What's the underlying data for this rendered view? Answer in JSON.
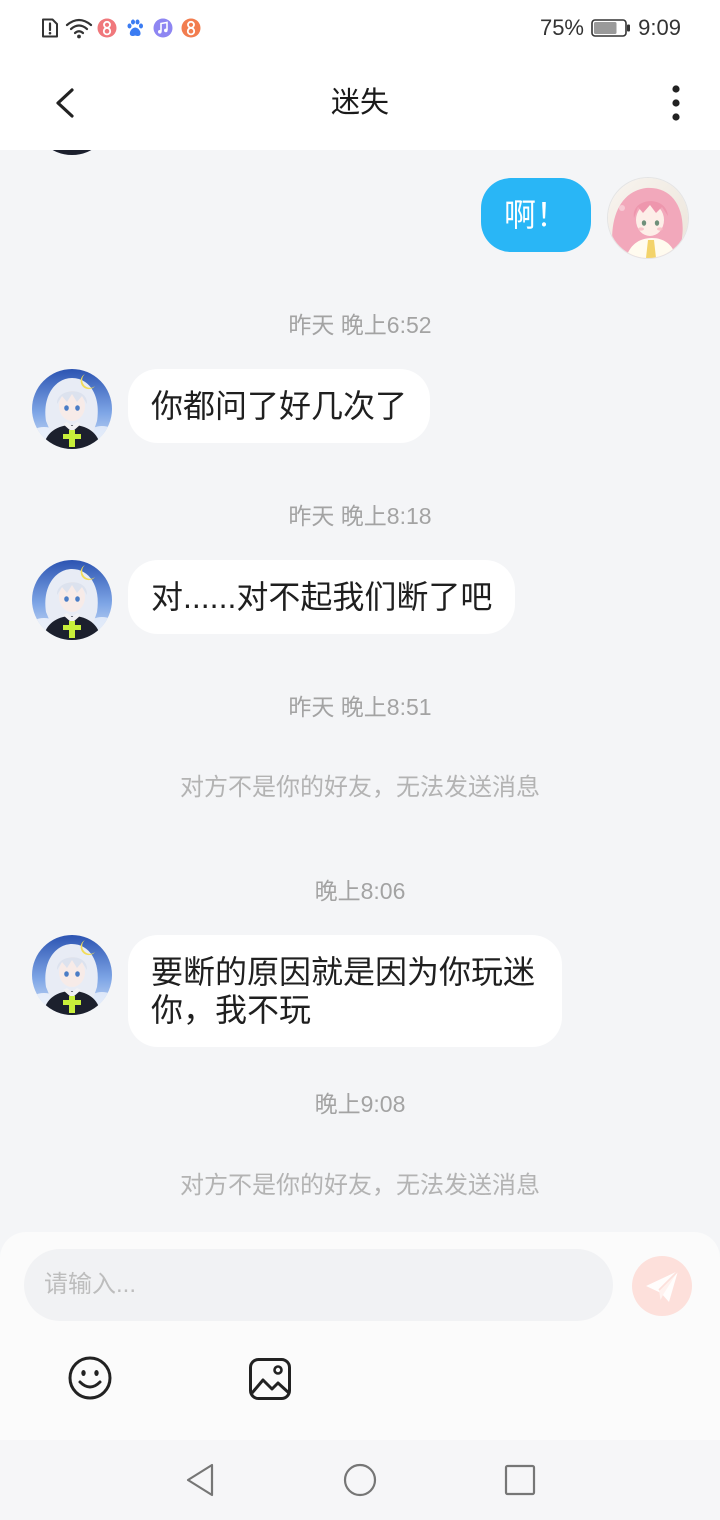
{
  "status_bar": {
    "left_icons": [
      "sim-alert-icon",
      "wifi-icon",
      "app-pink-icon",
      "baidu-paw-icon",
      "music-note-icon",
      "app-orange-icon"
    ],
    "battery_percent": "75%",
    "battery_level": 0.75,
    "battery_icon": "battery-icon",
    "time": "9:09"
  },
  "header": {
    "title": "迷失",
    "back_icon": "chevron-left-icon",
    "more_icon": "more-vertical-icon"
  },
  "messages": [
    {
      "sent": "啊！"
    },
    {
      "timestamp": "昨天 晚上6:52"
    },
    {
      "received": "你都问了好几次了"
    },
    {
      "timestamp": "昨天 晚上8:18"
    },
    {
      "received": "对......对不起我们断了吧"
    },
    {
      "timestamp": "昨天 晚上8:51"
    },
    {
      "notice": "对方不是你的好友，无法发送消息"
    },
    {
      "timestamp": "晚上8:06"
    },
    {
      "received": "要断的原因就是因为你玩迷你，我不玩"
    },
    {
      "timestamp": "晚上9:08"
    },
    {
      "notice": "对方不是你的好友，无法发送消息"
    }
  ],
  "composer": {
    "placeholder": "请输入...",
    "send_icon": "send-icon",
    "emoji_icon": "emoji-icon",
    "image_icon": "image-icon"
  },
  "nav_bar": {
    "icons": [
      "nav-back-icon",
      "nav-home-icon",
      "nav-recents-icon"
    ]
  },
  "colors": {
    "sent_bubble": "#29b6f6",
    "received_bubble": "#ffffff",
    "chat_background": "#f4f5f7",
    "send_button_disabled": "#fde0db"
  }
}
